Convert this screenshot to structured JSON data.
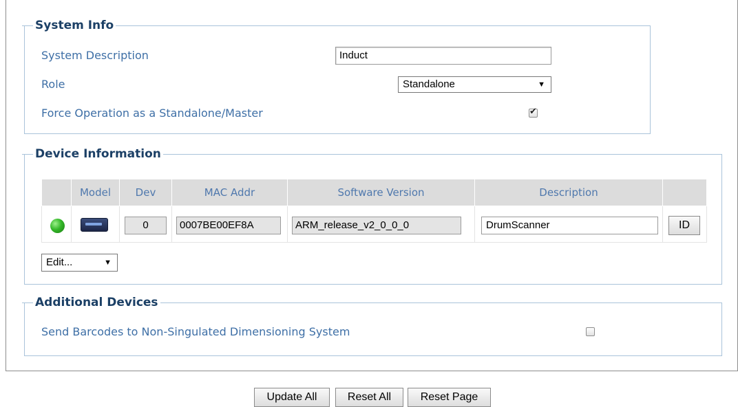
{
  "system_info": {
    "legend": "System Info",
    "description_label": "System Description",
    "description_value": "Induct",
    "role_label": "Role",
    "role_value": "Standalone",
    "force_label": "Force Operation as a Standalone/Master",
    "force_checked": true
  },
  "device_info": {
    "legend": "Device Information",
    "columns": [
      "",
      "Model",
      "Dev",
      "MAC Addr",
      "Software Version",
      "Description",
      ""
    ],
    "rows": [
      {
        "status": "online",
        "model_icon": "scanner-icon",
        "dev": "0",
        "mac": "0007BE00EF8A",
        "software_version": "ARM_release_v2_0_0_0",
        "description": "DrumScanner",
        "id_button": "ID"
      }
    ],
    "edit_select": "Edit..."
  },
  "additional_devices": {
    "legend": "Additional Devices",
    "send_barcodes_label": "Send Barcodes to Non-Singulated Dimensioning System",
    "send_barcodes_checked": false
  },
  "buttons": {
    "update_all": "Update All",
    "reset_all": "Reset All",
    "reset_page": "Reset Page"
  },
  "colors": {
    "label": "#3e6fa6",
    "legend": "#1c4066",
    "fieldset_border": "#a9c3da",
    "status_online": "#35b82a"
  }
}
